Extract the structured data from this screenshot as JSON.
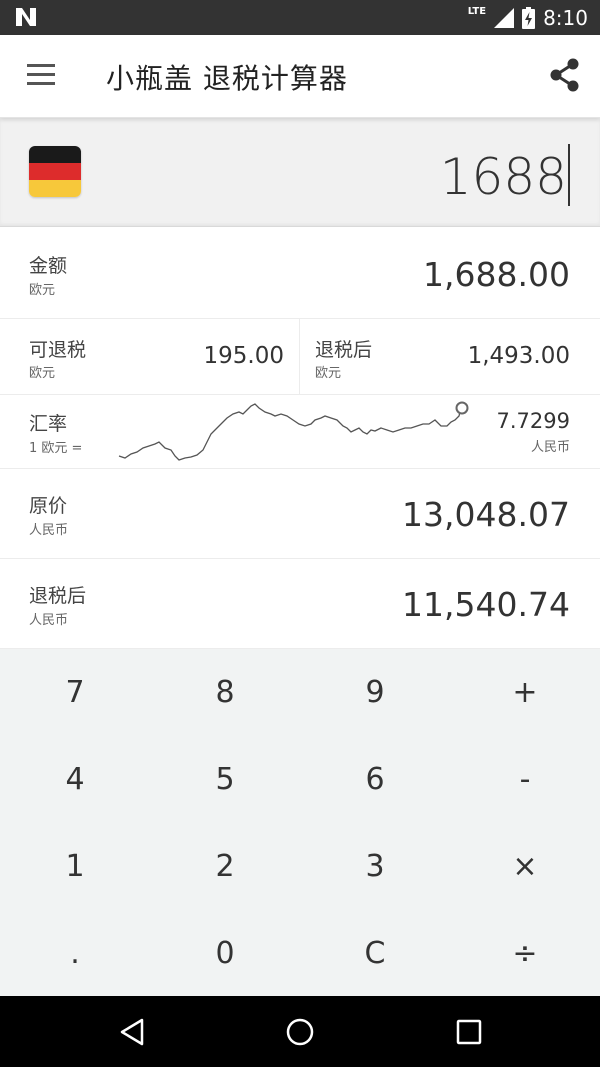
{
  "status_bar": {
    "network": "LTE",
    "time": "8:10"
  },
  "app_bar": {
    "title": "小瓶盖 退税计算器"
  },
  "input": {
    "value": "1688"
  },
  "rows": {
    "amount": {
      "label": "金额",
      "unit": "欧元",
      "value": "1,688.00"
    },
    "refundable": {
      "label": "可退税",
      "unit": "欧元",
      "value": "195.00"
    },
    "after_refund_eur": {
      "label": "退税后",
      "unit": "欧元",
      "value": "1,493.00"
    },
    "rate": {
      "label": "汇率",
      "sub": "1 欧元 =",
      "value": "7.7299",
      "unit": "人民币"
    },
    "original": {
      "label": "原价",
      "unit": "人民币",
      "value": "13,048.07"
    },
    "after_refund_cny": {
      "label": "退税后",
      "unit": "人民币",
      "value": "11,540.74"
    }
  },
  "keypad": {
    "keys": [
      [
        "7",
        "8",
        "9",
        "+"
      ],
      [
        "4",
        "5",
        "6",
        "-"
      ],
      [
        "1",
        "2",
        "3",
        "×"
      ],
      [
        ".",
        "0",
        "C",
        "÷"
      ]
    ]
  },
  "colors": {
    "flag_black": "#1a1a1a",
    "flag_red": "#dd2c2c",
    "flag_gold": "#f7c83a"
  }
}
